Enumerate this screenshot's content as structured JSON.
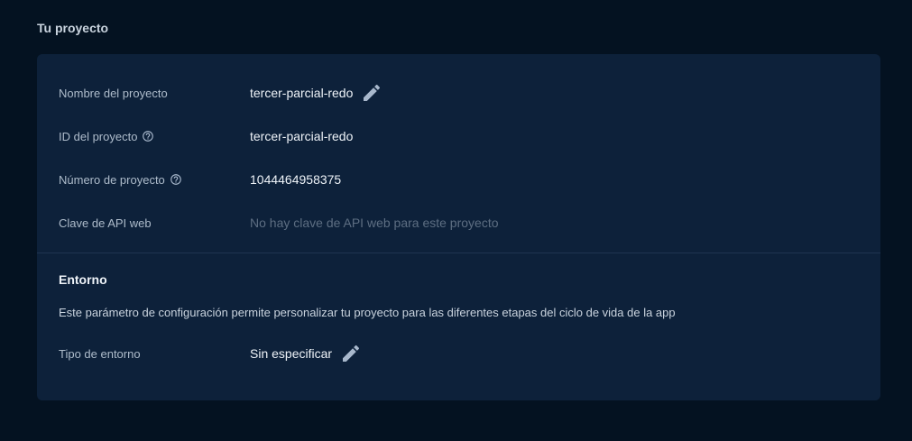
{
  "section": {
    "title": "Tu proyecto"
  },
  "project": {
    "name_label": "Nombre del proyecto",
    "name_value": "tercer-parcial-redo",
    "id_label": "ID del proyecto",
    "id_value": "tercer-parcial-redo",
    "number_label": "Número de proyecto",
    "number_value": "1044464958375",
    "api_key_label": "Clave de API web",
    "api_key_value": "No hay clave de API web para este proyecto"
  },
  "environment": {
    "title": "Entorno",
    "description": "Este parámetro de configuración permite personalizar tu proyecto para las diferentes etapas del ciclo de vida de la app",
    "type_label": "Tipo de entorno",
    "type_value": "Sin especificar"
  },
  "colors": {
    "background": "#041221",
    "card": "#0d213a",
    "icon": "#a8b8cc"
  },
  "icons": {
    "edit": "pencil-icon",
    "help": "help-circle-icon"
  }
}
